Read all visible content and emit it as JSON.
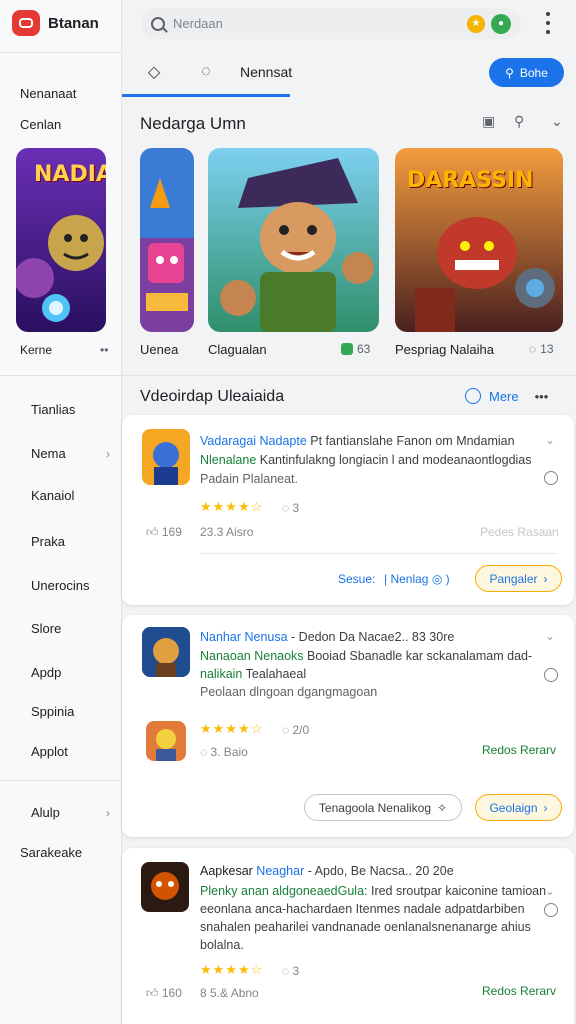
{
  "app": {
    "brand": "Btanan"
  },
  "sidebar": {
    "header_labels": [
      "Nenanaat",
      "Cenlan"
    ],
    "thumb_caption": "Kerne",
    "thumb_dots": "••",
    "nav": [
      "Tianlias",
      "Nema",
      "Kanaiol",
      "Praka",
      "Unerocins",
      "Slore",
      "Apdp",
      "Sppinia",
      "Applot",
      "Alulp",
      "Sarakeake"
    ]
  },
  "search": {
    "placeholder": "Nerdaan"
  },
  "tabs": {
    "label": "Nennsat",
    "primary_button": "Bohe"
  },
  "carousel": {
    "title": "Nedarga Umn",
    "cards": [
      {
        "caption": "Uenea"
      },
      {
        "caption": "Clagualan",
        "rating": "63"
      },
      {
        "caption": "Pespriag Nalaiha",
        "rating": "13"
      }
    ],
    "banner_texts": [
      "NADIA",
      "DARASSIN"
    ]
  },
  "videos": {
    "title": "Vdeoirdap Uleaiaida",
    "more_label": "Mere",
    "items": [
      {
        "line1_blue": "Vadaragai Nadapte",
        "line1_rest": " Pt fantianslahe Fanon om Mndamian",
        "line2_green": "Nlenalane",
        "line2_rest": " Kantinfulakng longiacin l and modeanaontlogdias",
        "line3": "Padain Plalaneat.",
        "rating_count": "3",
        "likes": "169",
        "meta": "23.3 Aisro",
        "faint": "Pedes Rasaan",
        "action_left": "Sesue:",
        "action_mid": "Nenlag",
        "button": "Pangaler"
      },
      {
        "line1_blue": "Nanhar Nenusa",
        "line1_rest": " - Dedon Da Nacae2.. 83 30re",
        "line2_green": "Nanaoan Nenaoks",
        "line2_rest": " Booiad Sbanadle kar sckanalamam dad-",
        "line3_green": "nalikain",
        "line3_rest": " Tealahaeal",
        "line4": "Peolaan dlngoan dgangmagoan",
        "rating_count": "2/0",
        "meta": "3. Baio",
        "link": "Redos Rerarv",
        "btn_left": "Tenagoola Nenalikog",
        "button": "Geolaign"
      },
      {
        "line1_dark": "Aapkesar",
        "line1_blue": " Neaghar",
        "line1_rest": " - Apdo, Be Nacsa.. 20 20e",
        "line2_green": "Plenky anan aldgoneaedGula:",
        "line2_rest": " Ired sroutpar kaiconine tamioan",
        "line3": "eeonlana anca-hachardaen Itenmes nadale adpatdarbiben",
        "line4": "snahalen peaharilei vandnanade oenlanalsnenanarge ahius",
        "line5": "bolalna.",
        "rating_count": "3",
        "likes": "160",
        "meta": "8 5.& Abno",
        "link": "Redos Rerarv"
      }
    ]
  }
}
